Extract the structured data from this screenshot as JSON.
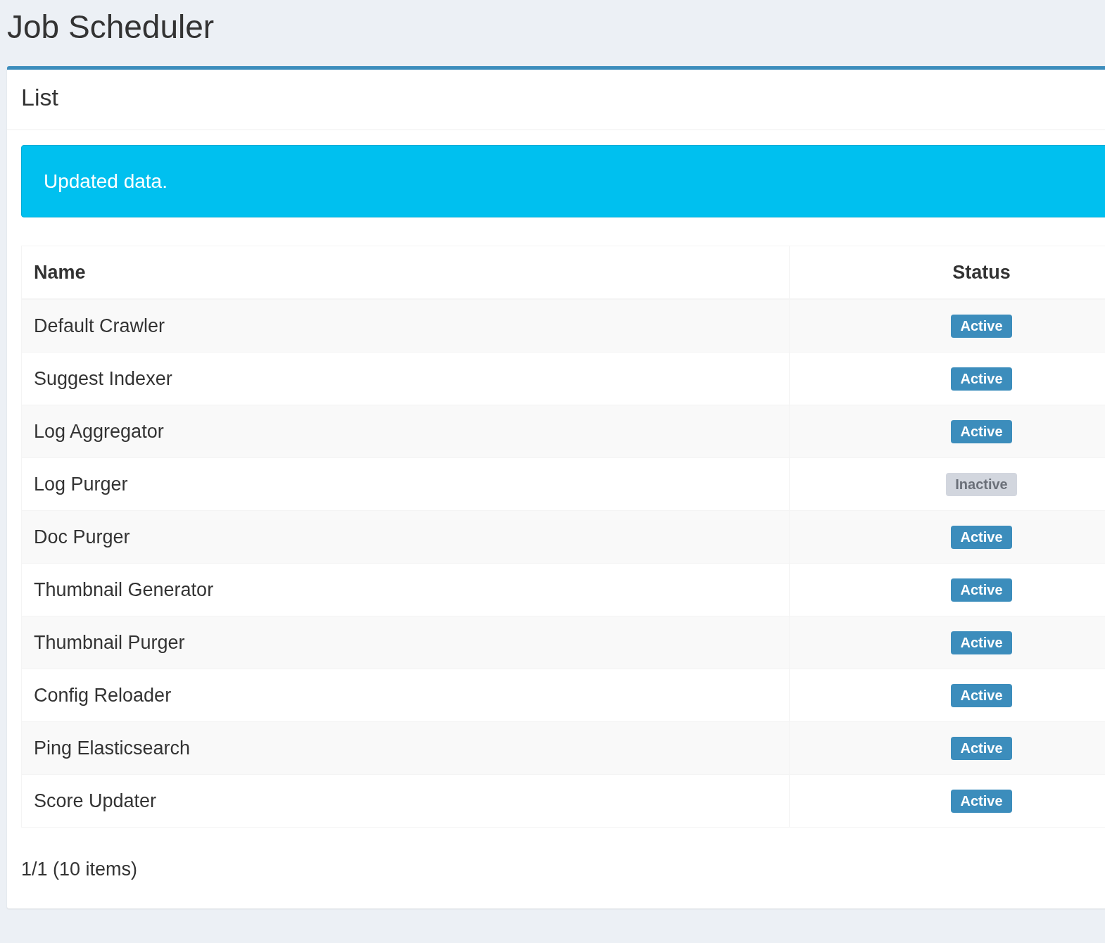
{
  "page_title": "Job Scheduler",
  "box": {
    "title": "List",
    "alert": {
      "message": "Updated data."
    },
    "table": {
      "columns": [
        "Name",
        "Status"
      ],
      "rows": [
        {
          "name": "Default Crawler",
          "status": "Active",
          "active": true
        },
        {
          "name": "Suggest Indexer",
          "status": "Active",
          "active": true
        },
        {
          "name": "Log Aggregator",
          "status": "Active",
          "active": true
        },
        {
          "name": "Log Purger",
          "status": "Inactive",
          "active": false
        },
        {
          "name": "Doc Purger",
          "status": "Active",
          "active": true
        },
        {
          "name": "Thumbnail Generator",
          "status": "Active",
          "active": true
        },
        {
          "name": "Thumbnail Purger",
          "status": "Active",
          "active": true
        },
        {
          "name": "Config Reloader",
          "status": "Active",
          "active": true
        },
        {
          "name": "Ping Elasticsearch",
          "status": "Active",
          "active": true
        },
        {
          "name": "Score Updater",
          "status": "Active",
          "active": true
        }
      ]
    },
    "pagination": "1/1 (10 items)"
  }
}
